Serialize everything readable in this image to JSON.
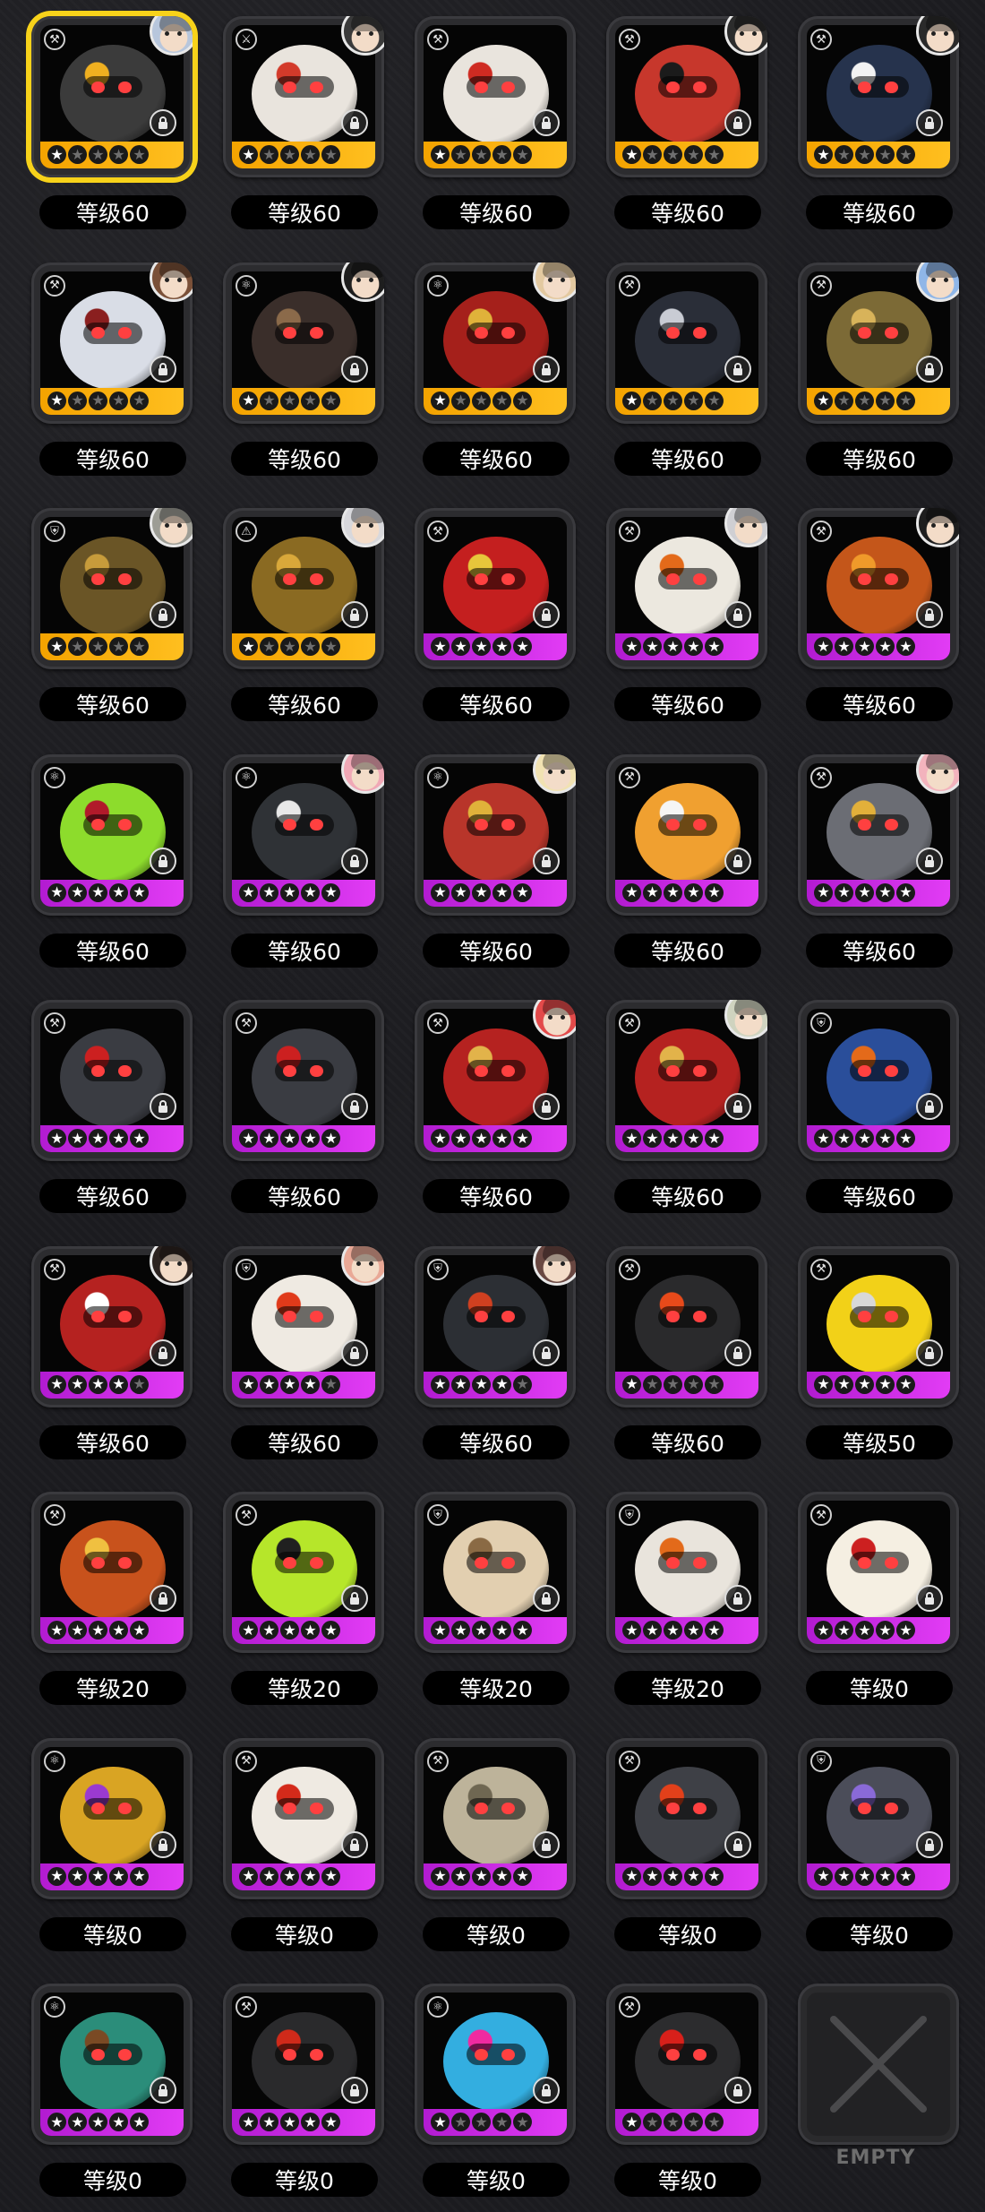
{
  "screen_title": "",
  "empty_label": "EMPTY",
  "colors": {
    "selected_outline": "#f7d21a",
    "rank_s_bar": "#f4a300",
    "rank_a_bar": "#c52ae3",
    "badge_bg": "#000000"
  },
  "items": [
    {
      "level": "等级60",
      "rank": "orange",
      "stars": 1,
      "selected": true,
      "avatar": true,
      "body_color": "#3b3b3b",
      "accent": "#f0b020",
      "avatar_color": "#b7c6dc",
      "type_icon": "⚒"
    },
    {
      "level": "等级60",
      "rank": "orange",
      "stars": 1,
      "selected": false,
      "avatar": true,
      "body_color": "#e9e4dd",
      "accent": "#d33a2a",
      "avatar_color": "#3a3a3a",
      "type_icon": "⚔"
    },
    {
      "level": "等级60",
      "rank": "orange",
      "stars": 1,
      "selected": false,
      "avatar": false,
      "body_color": "#e9e4dd",
      "accent": "#cf2b22",
      "avatar_color": "#333",
      "type_icon": "⚒"
    },
    {
      "level": "等级60",
      "rank": "orange",
      "stars": 1,
      "selected": false,
      "avatar": true,
      "body_color": "#c7372c",
      "accent": "#1b1b1b",
      "avatar_color": "#2c2c2c",
      "type_icon": "⚒"
    },
    {
      "level": "等级60",
      "rank": "orange",
      "stars": 1,
      "selected": false,
      "avatar": true,
      "body_color": "#26334d",
      "accent": "#f2f2f2",
      "avatar_color": "#2a2a2a",
      "type_icon": "⚒"
    },
    {
      "level": "等级60",
      "rank": "orange",
      "stars": 1,
      "selected": false,
      "avatar": true,
      "body_color": "#d9dde6",
      "accent": "#8a1f1f",
      "avatar_color": "#7a5038",
      "type_icon": "⚒"
    },
    {
      "level": "等级60",
      "rank": "orange",
      "stars": 1,
      "selected": false,
      "avatar": true,
      "body_color": "#3a2e2a",
      "accent": "#8b6a4a",
      "avatar_color": "#1e1e1e",
      "type_icon": "⚛"
    },
    {
      "level": "等级60",
      "rank": "orange",
      "stars": 1,
      "selected": false,
      "avatar": true,
      "body_color": "#a5201b",
      "accent": "#e0b23a",
      "avatar_color": "#e3c9a0",
      "type_icon": "⚛"
    },
    {
      "level": "等级60",
      "rank": "orange",
      "stars": 1,
      "selected": false,
      "avatar": false,
      "body_color": "#2a2e38",
      "accent": "#c9ccd4",
      "avatar_color": "#333",
      "type_icon": "⚒"
    },
    {
      "level": "等级60",
      "rank": "orange",
      "stars": 1,
      "selected": false,
      "avatar": true,
      "body_color": "#7c6a36",
      "accent": "#d8b35a",
      "avatar_color": "#8fb6e8",
      "type_icon": "⚒"
    },
    {
      "level": "等级60",
      "rank": "orange",
      "stars": 1,
      "selected": false,
      "avatar": true,
      "body_color": "#6a5526",
      "accent": "#c79c3b",
      "avatar_color": "#9d9d95",
      "type_icon": "⛨"
    },
    {
      "level": "等级60",
      "rank": "orange",
      "stars": 1,
      "selected": false,
      "avatar": true,
      "body_color": "#8a6a22",
      "accent": "#d9a83a",
      "avatar_color": "#d8d8dc",
      "type_icon": "⚠"
    },
    {
      "level": "等级60",
      "rank": "purple",
      "stars": 5,
      "selected": false,
      "avatar": false,
      "body_color": "#c41f1f",
      "accent": "#e7c63b",
      "avatar_color": "#333",
      "type_icon": "⚒"
    },
    {
      "level": "等级60",
      "rank": "purple",
      "stars": 5,
      "selected": false,
      "avatar": true,
      "body_color": "#ece8df",
      "accent": "#e36a1a",
      "avatar_color": "#cfcfd3",
      "type_icon": "⚒"
    },
    {
      "level": "等级60",
      "rank": "purple",
      "stars": 5,
      "selected": false,
      "avatar": true,
      "body_color": "#c4561a",
      "accent": "#f09a2a",
      "avatar_color": "#1e1e1e",
      "type_icon": "⚒"
    },
    {
      "level": "等级60",
      "rank": "purple",
      "stars": 5,
      "selected": false,
      "avatar": false,
      "body_color": "#8ddc2c",
      "accent": "#b11a2a",
      "avatar_color": "#333",
      "type_icon": "⚛"
    },
    {
      "level": "等级60",
      "rank": "purple",
      "stars": 5,
      "selected": false,
      "avatar": true,
      "body_color": "#2f3236",
      "accent": "#e8e8e8",
      "avatar_color": "#f0a8b6",
      "type_icon": "⚛"
    },
    {
      "level": "等级60",
      "rank": "purple",
      "stars": 5,
      "selected": false,
      "avatar": true,
      "body_color": "#b8352a",
      "accent": "#e0b23a",
      "avatar_color": "#f1e2b2",
      "type_icon": "⚛"
    },
    {
      "level": "等级60",
      "rank": "purple",
      "stars": 5,
      "selected": false,
      "avatar": false,
      "body_color": "#f0a030",
      "accent": "#f5f5f5",
      "avatar_color": "#333",
      "type_icon": "⚒"
    },
    {
      "level": "等级60",
      "rank": "purple",
      "stars": 5,
      "selected": false,
      "avatar": true,
      "body_color": "#6b6d74",
      "accent": "#e2b03a",
      "avatar_color": "#f3b3bd",
      "type_icon": "⚒"
    },
    {
      "level": "等级60",
      "rank": "purple",
      "stars": 5,
      "selected": false,
      "avatar": false,
      "body_color": "#3a3c42",
      "accent": "#cc2020",
      "avatar_color": "#333",
      "type_icon": "⚒"
    },
    {
      "level": "等级60",
      "rank": "purple",
      "stars": 5,
      "selected": false,
      "avatar": false,
      "body_color": "#3a3c42",
      "accent": "#cc2020",
      "avatar_color": "#333",
      "type_icon": "⚒"
    },
    {
      "level": "等级60",
      "rank": "purple",
      "stars": 5,
      "selected": false,
      "avatar": true,
      "body_color": "#b52220",
      "accent": "#e2b34a",
      "avatar_color": "#e34a4a",
      "type_icon": "⚒"
    },
    {
      "level": "等级60",
      "rank": "purple",
      "stars": 5,
      "selected": false,
      "avatar": true,
      "body_color": "#b52220",
      "accent": "#e2b34a",
      "avatar_color": "#cfd3bf",
      "type_icon": "⚒"
    },
    {
      "level": "等级60",
      "rank": "purple",
      "stars": 5,
      "selected": false,
      "avatar": false,
      "body_color": "#2a4e9a",
      "accent": "#e46a1a",
      "avatar_color": "#333",
      "type_icon": "⛨"
    },
    {
      "level": "等级60",
      "rank": "purple",
      "stars": 4,
      "selected": false,
      "avatar": true,
      "body_color": "#b52220",
      "accent": "#ffffff",
      "avatar_color": "#2c2320",
      "type_icon": "⚒"
    },
    {
      "level": "等级60",
      "rank": "purple",
      "stars": 4,
      "selected": false,
      "avatar": true,
      "body_color": "#efeae2",
      "accent": "#e03a1a",
      "avatar_color": "#e9a896",
      "type_icon": "⛨"
    },
    {
      "level": "等级60",
      "rank": "purple",
      "stars": 4,
      "selected": false,
      "avatar": true,
      "body_color": "#2c2f34",
      "accent": "#d04020",
      "avatar_color": "#6a4842",
      "type_icon": "⛨"
    },
    {
      "level": "等级60",
      "rank": "purple",
      "stars": 1,
      "selected": false,
      "avatar": false,
      "body_color": "#2a2a2c",
      "accent": "#e84a1a",
      "avatar_color": "#333",
      "type_icon": "⚒"
    },
    {
      "level": "等级50",
      "rank": "purple",
      "stars": 5,
      "selected": false,
      "avatar": false,
      "body_color": "#f2d118",
      "accent": "#d8d8d8",
      "avatar_color": "#333",
      "type_icon": "⚒"
    },
    {
      "level": "等级20",
      "rank": "purple",
      "stars": 5,
      "selected": false,
      "avatar": false,
      "body_color": "#c8521c",
      "accent": "#f0c040",
      "avatar_color": "#333",
      "type_icon": "⚒"
    },
    {
      "level": "等级20",
      "rank": "purple",
      "stars": 5,
      "selected": false,
      "avatar": false,
      "body_color": "#b6e62a",
      "accent": "#202020",
      "avatar_color": "#333",
      "type_icon": "⚒"
    },
    {
      "level": "等级20",
      "rank": "purple",
      "stars": 5,
      "selected": false,
      "avatar": false,
      "body_color": "#e2cfb0",
      "accent": "#8a6a44",
      "avatar_color": "#333",
      "type_icon": "⛨"
    },
    {
      "level": "等级20",
      "rank": "purple",
      "stars": 5,
      "selected": false,
      "avatar": false,
      "body_color": "#e9e4dc",
      "accent": "#e36a1a",
      "avatar_color": "#333",
      "type_icon": "⛨"
    },
    {
      "level": "等级0",
      "rank": "purple",
      "stars": 5,
      "selected": false,
      "avatar": false,
      "body_color": "#f5efe2",
      "accent": "#cc2020",
      "avatar_color": "#333",
      "type_icon": "⚒"
    },
    {
      "level": "等级0",
      "rank": "purple",
      "stars": 5,
      "selected": false,
      "avatar": false,
      "body_color": "#d9a423",
      "accent": "#9a3ad0",
      "avatar_color": "#333",
      "type_icon": "⚛"
    },
    {
      "level": "等级0",
      "rank": "purple",
      "stars": 5,
      "selected": false,
      "avatar": false,
      "body_color": "#efeae2",
      "accent": "#d42a1a",
      "avatar_color": "#333",
      "type_icon": "⚒"
    },
    {
      "level": "等级0",
      "rank": "purple",
      "stars": 5,
      "selected": false,
      "avatar": false,
      "body_color": "#bdb39a",
      "accent": "#6f6752",
      "avatar_color": "#333",
      "type_icon": "⚒"
    },
    {
      "level": "等级0",
      "rank": "purple",
      "stars": 5,
      "selected": false,
      "avatar": false,
      "body_color": "#3e4046",
      "accent": "#e2401a",
      "avatar_color": "#333",
      "type_icon": "⚒"
    },
    {
      "level": "等级0",
      "rank": "purple",
      "stars": 5,
      "selected": false,
      "avatar": false,
      "body_color": "#4b4d59",
      "accent": "#8a6ad8",
      "avatar_color": "#333",
      "type_icon": "⛨"
    },
    {
      "level": "等级0",
      "rank": "purple",
      "stars": 5,
      "selected": false,
      "avatar": false,
      "body_color": "#2b8d7a",
      "accent": "#7a4a24",
      "avatar_color": "#333",
      "type_icon": "⚛"
    },
    {
      "level": "等级0",
      "rank": "purple",
      "stars": 5,
      "selected": false,
      "avatar": false,
      "body_color": "#2a2a2c",
      "accent": "#d02a1a",
      "avatar_color": "#333",
      "type_icon": "⚒"
    },
    {
      "level": "等级0",
      "rank": "purple",
      "stars": 1,
      "selected": false,
      "avatar": false,
      "body_color": "#33aee0",
      "accent": "#f02aa0",
      "avatar_color": "#333",
      "type_icon": "⚛"
    },
    {
      "level": "等级0",
      "rank": "purple",
      "stars": 1,
      "selected": false,
      "avatar": false,
      "body_color": "#2c2c2e",
      "accent": "#d8201a",
      "avatar_color": "#333",
      "type_icon": "⚒"
    }
  ]
}
